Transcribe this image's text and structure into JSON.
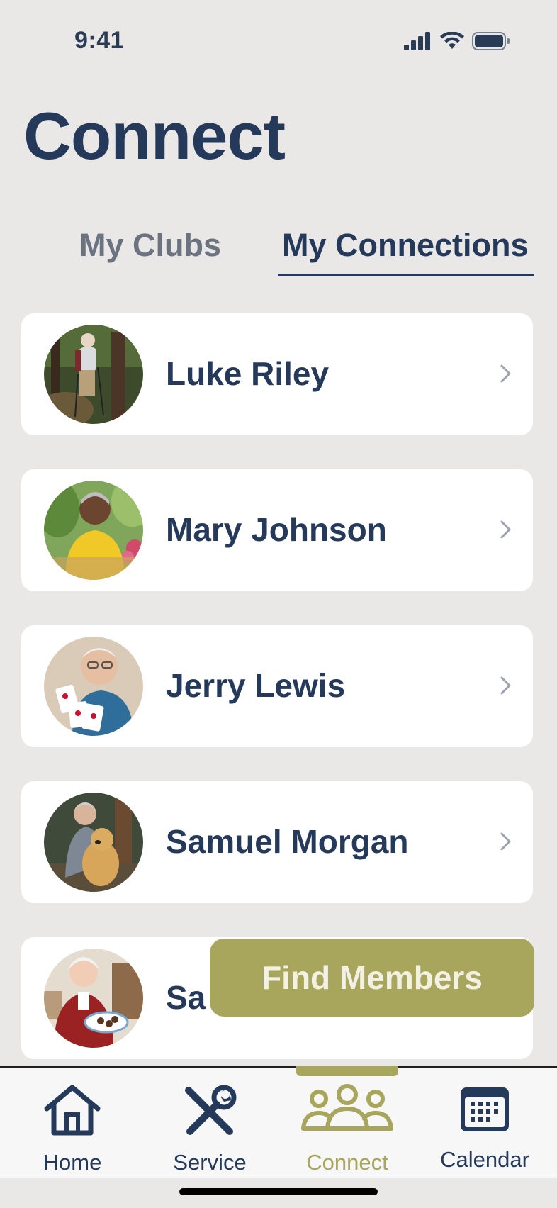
{
  "status_bar": {
    "time": "9:41"
  },
  "header": {
    "title": "Connect"
  },
  "tabs": [
    {
      "label": "My Clubs",
      "active": false
    },
    {
      "label": "My Connections",
      "active": true
    }
  ],
  "connections": [
    {
      "name": "Luke Riley"
    },
    {
      "name": "Mary Johnson"
    },
    {
      "name": "Jerry Lewis"
    },
    {
      "name": "Samuel Morgan"
    },
    {
      "name": "Sa"
    }
  ],
  "find_members": {
    "label": "Find Members"
  },
  "bottom_nav": [
    {
      "label": "Home",
      "icon": "house-icon",
      "active": false
    },
    {
      "label": "Service",
      "icon": "tools-icon",
      "active": false
    },
    {
      "label": "Connect",
      "icon": "people-icon",
      "active": true
    },
    {
      "label": "Calendar",
      "icon": "calendar-icon",
      "active": false
    }
  ],
  "colors": {
    "primary": "#253A5A",
    "accent": "#A8A55C",
    "background": "#E9E8E7",
    "card": "#FFFFFF"
  }
}
